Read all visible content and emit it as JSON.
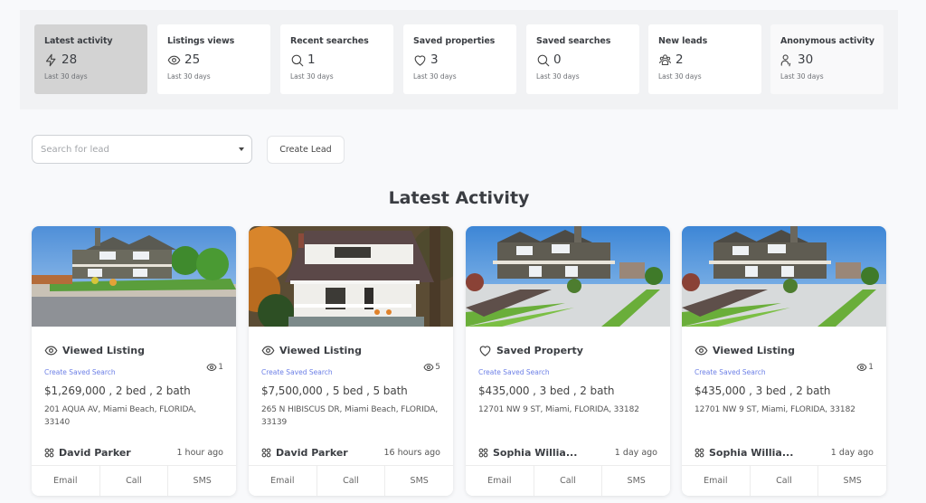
{
  "stats": [
    {
      "label": "Latest activity",
      "icon": "lightning-icon",
      "value": "28",
      "sub": "Last 30 days"
    },
    {
      "label": "Listings views",
      "icon": "eye-icon",
      "value": "25",
      "sub": "Last 30 days"
    },
    {
      "label": "Recent searches",
      "icon": "search-icon",
      "value": "1",
      "sub": "Last 30 days"
    },
    {
      "label": "Saved properties",
      "icon": "heart-icon",
      "value": "3",
      "sub": "Last 30 days"
    },
    {
      "label": "Saved searches",
      "icon": "search-icon",
      "value": "0",
      "sub": "Last 30 days"
    },
    {
      "label": "New leads",
      "icon": "group-icon",
      "value": "2",
      "sub": "Last 30 days"
    },
    {
      "label": "Anonymous activity",
      "icon": "anonymous-user-icon",
      "value": "30",
      "sub": "Last 30 days"
    }
  ],
  "search": {
    "placeholder": "Search for lead",
    "value": ""
  },
  "create_lead_label": "Create Lead",
  "section_title": "Latest Activity",
  "colors": {
    "link": "#6c7fe6",
    "active_stat": "#d3d3d3",
    "panel": "#f1f2f4",
    "page": "#f8f9fb"
  },
  "activities": [
    {
      "type": "Viewed Listing",
      "type_icon": "eye-icon",
      "view_count": "1",
      "link": "Create Saved Search",
      "price_line": "$1,269,000 , 2 bed , 2 bath",
      "address": "201 AQUA AV, Miami Beach, FLORIDA, 33140",
      "lead_name": "David Parker",
      "time": "1 hour ago",
      "actions": [
        "Email",
        "Call",
        "SMS"
      ]
    },
    {
      "type": "Viewed Listing",
      "type_icon": "eye-icon",
      "view_count": "5",
      "link": "Create Saved Search",
      "price_line": "$7,500,000 , 5 bed , 5 bath",
      "address": "265 N HIBISCUS DR, Miami Beach, FLORIDA, 33139",
      "lead_name": "David Parker",
      "time": "16 hours ago",
      "actions": [
        "Email",
        "Call",
        "SMS"
      ]
    },
    {
      "type": "Saved Property",
      "type_icon": "heart-icon",
      "view_count": null,
      "link": "Create Saved Search",
      "price_line": "$435,000 , 3 bed , 2 bath",
      "address": "12701 NW 9 ST, Miami, FLORIDA, 33182",
      "lead_name": "Sophia Willia...",
      "time": "1 day ago",
      "actions": [
        "Email",
        "Call",
        "SMS"
      ]
    },
    {
      "type": "Viewed Listing",
      "type_icon": "eye-icon",
      "view_count": "1",
      "link": "Create Saved Search",
      "price_line": "$435,000 , 3 bed , 2 bath",
      "address": "12701 NW 9 ST, Miami, FLORIDA, 33182",
      "lead_name": "Sophia Willia...",
      "time": "1 day ago",
      "actions": [
        "Email",
        "Call",
        "SMS"
      ]
    }
  ]
}
